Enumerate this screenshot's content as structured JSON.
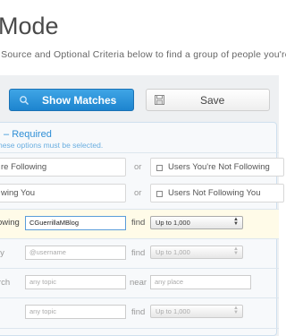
{
  "header": {
    "title": "Mode",
    "subtitle": "a Source and Optional Criteria below to find a group of people you're"
  },
  "toolbar": {
    "show_matches_label": "Show Matches",
    "save_label": "Save"
  },
  "required": {
    "title": "Required",
    "subtitle": "hese options must be selected."
  },
  "source_rows": [
    {
      "left_label": "re Following",
      "or": "or",
      "right_label": "Users You're Not Following"
    },
    {
      "left_label": "wing You",
      "or": "or",
      "right_label": "Users Not Following You"
    }
  ],
  "criteria": {
    "following": {
      "label": "owing",
      "value": "CGuerrillaMBlog",
      "find": "find",
      "select": "Up to 1,000"
    },
    "reply": {
      "label": "ly",
      "placeholder": "@username",
      "find": "find",
      "select": "Up to 1,000"
    },
    "search": {
      "label": "rch",
      "placeholder": "any topic",
      "near": "near",
      "place_placeholder": "any place"
    },
    "topic": {
      "placeholder": "any topic",
      "find": "find",
      "select": "Up to 1,000"
    }
  },
  "colors": {
    "accent": "#2f8fd6",
    "button_blue": "#1d84cf"
  },
  "icons": {
    "show_matches": "search-icon",
    "save": "floppy-disk-icon",
    "select": "up-down-arrows-icon"
  }
}
